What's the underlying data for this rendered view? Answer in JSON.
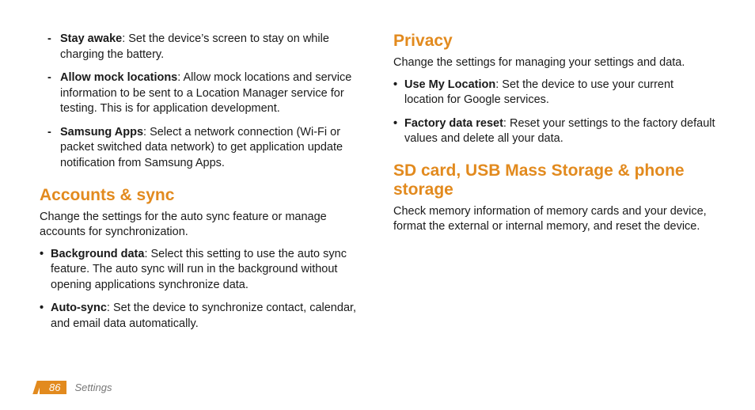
{
  "left": {
    "dev_options": [
      {
        "term": "Stay awake",
        "desc": ": Set the device’s screen to stay on while charging the battery."
      },
      {
        "term": "Allow mock locations",
        "desc": ": Allow mock locations and service information to be sent to a Location Manager service for testing. This is for application development."
      },
      {
        "term": "Samsung Apps",
        "desc": ": Select a network connection (Wi-Fi or packet switched data network) to get application update notification from Samsung Apps."
      }
    ],
    "accounts_heading": "Accounts & sync",
    "accounts_intro": "Change the settings for the auto sync feature or manage accounts for synchronization.",
    "accounts_items": [
      {
        "term": "Background data",
        "desc": ": Select this setting to use the auto sync feature. The auto sync will run in the background without opening applications synchronize data."
      },
      {
        "term": "Auto-sync",
        "desc": ": Set the device to synchronize contact, calendar, and email data automatically."
      }
    ]
  },
  "right": {
    "privacy_heading": "Privacy",
    "privacy_intro": "Change the settings for managing your settings and data.",
    "privacy_items": [
      {
        "term": "Use My Location",
        "desc": ": Set the device to use your current location for Google services."
      },
      {
        "term": "Factory data reset",
        "desc": ": Reset your settings to the factory default values and delete all your data."
      }
    ],
    "storage_heading": "SD card, USB Mass Storage & phone storage",
    "storage_intro": "Check memory information of memory cards and your device, format the external or internal memory, and reset the device."
  },
  "footer": {
    "page_number": "86",
    "section": "Settings"
  }
}
